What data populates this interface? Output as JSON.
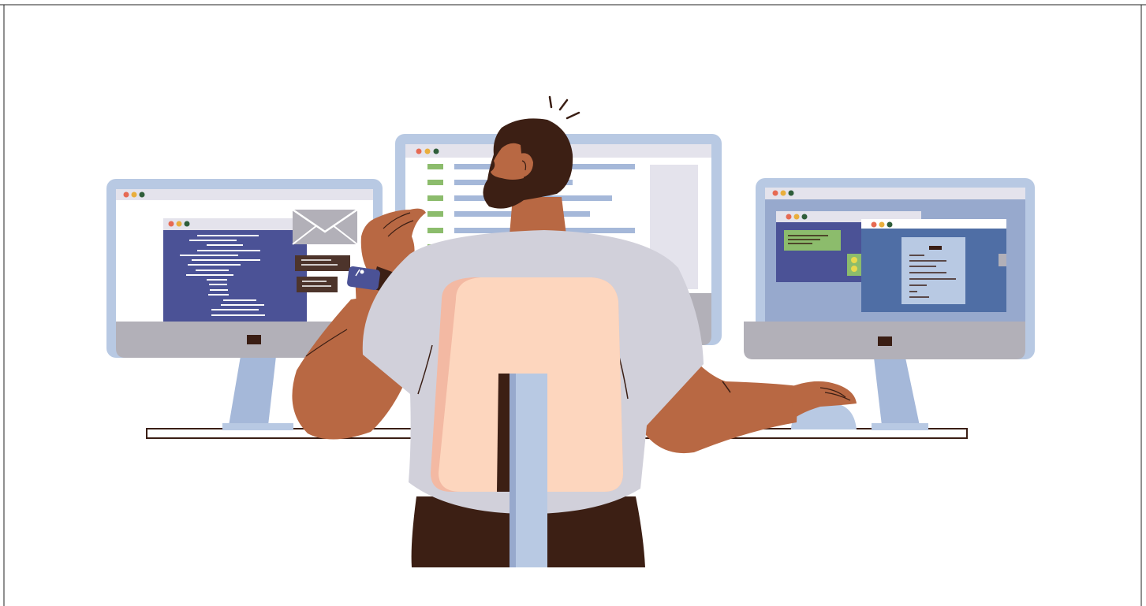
{
  "image": {
    "subject": "man-at-three-monitor-workstation",
    "icons": [
      "envelope-icon",
      "smartwatch-icon",
      "alert-marks-icon",
      "computer-mouse-icon"
    ]
  },
  "colors": {
    "background": "#ffffff",
    "frame": "#b8c9e3",
    "stand_gray": "#b2b0b8",
    "code_panel": "#4b5296",
    "green_bar": "#8cbc6c",
    "blue_bar": "#a5b8d9",
    "skin": "#b86843",
    "hair": "#3c1f14",
    "shirt": "#d1d0da",
    "chair_back": "#fdd6be",
    "chair_pole": "#b8c9e3",
    "window_dot_red": "#e66a53",
    "window_dot_yellow": "#e9ae3c",
    "window_dot_green": "#2f5e3a",
    "chat_bubble": "#4d342b",
    "right_window": "#4f6ea5",
    "document_paper": "#b8c9e3"
  }
}
